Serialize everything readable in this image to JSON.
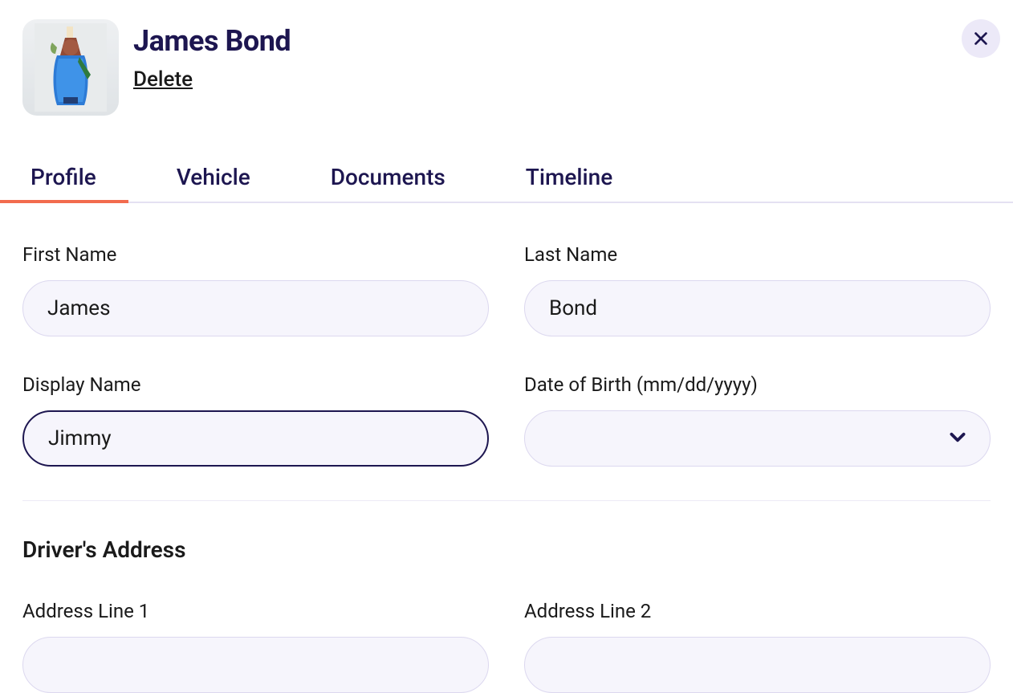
{
  "header": {
    "name": "James Bond",
    "delete_label": "Delete"
  },
  "tabs": [
    {
      "label": "Profile",
      "active": true
    },
    {
      "label": "Vehicle",
      "active": false
    },
    {
      "label": "Documents",
      "active": false
    },
    {
      "label": "Timeline",
      "active": false
    }
  ],
  "form": {
    "first_name": {
      "label": "First Name",
      "value": "James"
    },
    "last_name": {
      "label": "Last Name",
      "value": "Bond"
    },
    "display_name": {
      "label": "Display Name",
      "value": "Jimmy"
    },
    "dob": {
      "label": "Date of Birth (mm/dd/yyyy)",
      "value": ""
    },
    "section_address_title": "Driver's Address",
    "address1": {
      "label": "Address Line 1",
      "value": ""
    },
    "address2": {
      "label": "Address Line 2",
      "value": ""
    }
  },
  "colors": {
    "accent": "#f26b4e",
    "primary_text": "#1d1650",
    "input_bg": "#f6f5fc",
    "input_border": "#dcd8ef"
  }
}
